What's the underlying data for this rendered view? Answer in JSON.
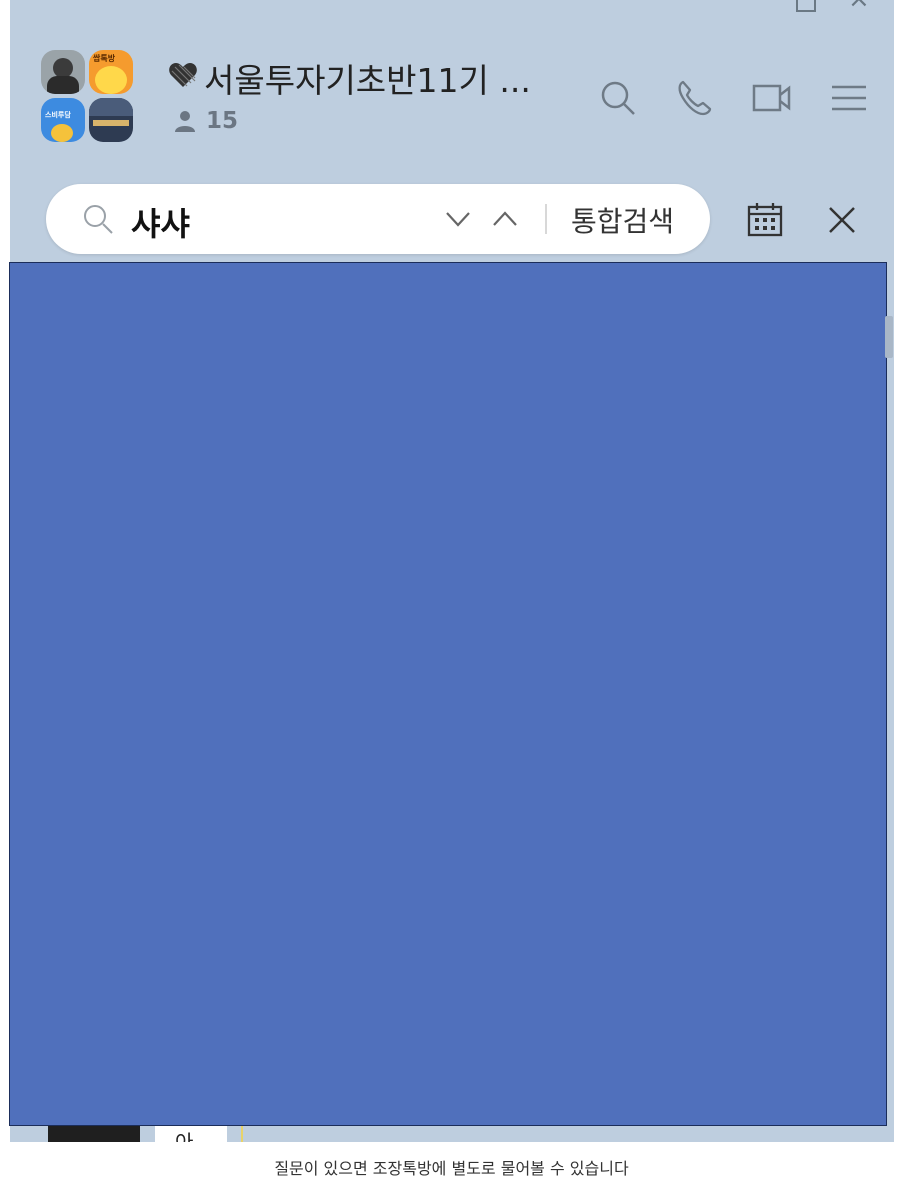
{
  "chat": {
    "title": "💜서울투자기초반11기 ...",
    "title_text": "서울투자기초반11기 ...",
    "heart": "♥",
    "member_count": "15",
    "avatar_labels": {
      "top_right": "쌉톡방",
      "bottom_left": "스비루담"
    }
  },
  "search": {
    "query": "샤샤",
    "integrated_search_label": "통합검색"
  },
  "partial_message": {
    "bubble_text": "아"
  },
  "caption": "질문이 있으면 조장톡방에 별도로 물어볼 수 있습니다",
  "colors": {
    "window_bg": "#becedf",
    "content_overlay": "#5070bc",
    "search_bg": "#ffffff"
  },
  "icons": {
    "header": [
      "search-icon",
      "phone-icon",
      "video-icon",
      "menu-icon"
    ],
    "search": [
      "magnifier-icon",
      "chevron-down-icon",
      "chevron-up-icon"
    ],
    "toolbar": [
      "calendar-icon",
      "close-icon"
    ]
  }
}
